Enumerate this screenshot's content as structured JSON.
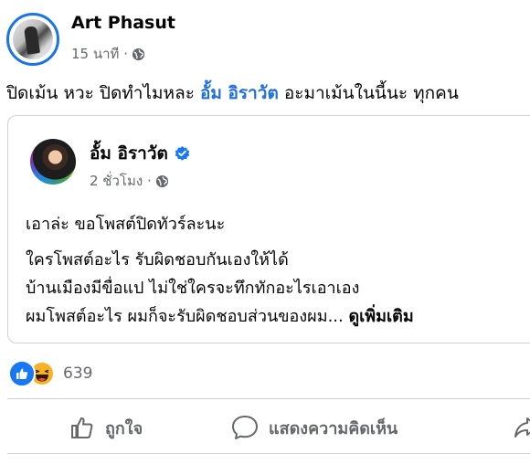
{
  "post": {
    "author": "Art Phasut",
    "time": "15 นาที ·",
    "privacy_icon": "globe-icon",
    "text_before": "ปิดเม้น หวะ ปิดทำไมหละ ",
    "mention": "อั้ม อิราวัต",
    "text_after": " อะมาเม้นในนี้นะ ทุกคน"
  },
  "shared": {
    "author": "อั้ม อิราวัต",
    "verified_icon": "verified-badge-icon",
    "time": "2 ชั่วโมง ·",
    "line1": "เอาล่ะ ขอโพสต์ปิดทัวร์ละนะ",
    "line2": "ใครโพสต์อะไร รับผิดชอบกันเองให้ได้",
    "line3": "บ้านเมืองมีขื่อแป ไม่ใช่ใครจะทึกทักอะไรเอาเอง",
    "line4": "ผมโพสต์อะไร ผมก็จะรับผิดชอบส่วนของผม... ",
    "see_more": "ดูเพิ่มเติม"
  },
  "reactions": {
    "types": [
      "like-icon",
      "haha-icon"
    ],
    "count": "639"
  },
  "actions": {
    "like": "ถูกใจ",
    "comment": "แสดงความคิดเห็น"
  },
  "colors": {
    "accent": "#1877f2",
    "mention": "#216fdb",
    "secondary_text": "#65676b",
    "divider": "#ced0d4"
  }
}
